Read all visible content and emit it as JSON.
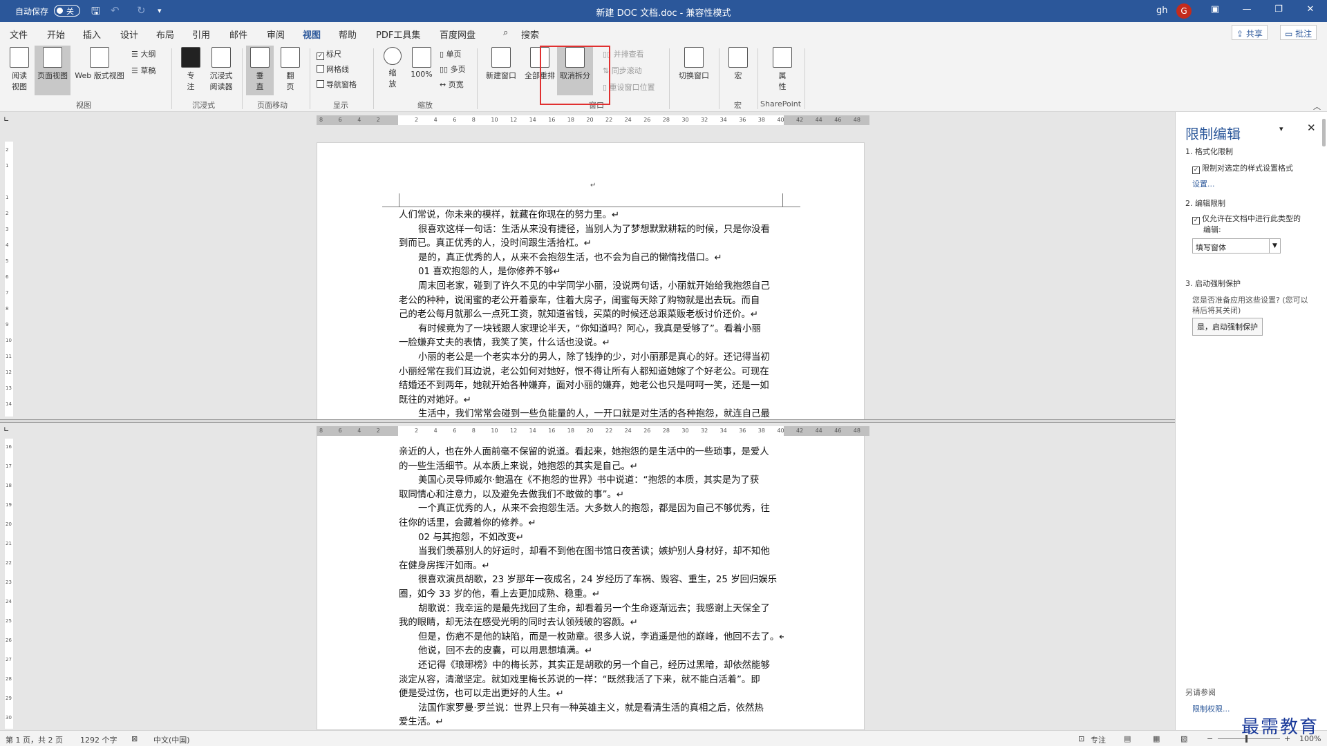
{
  "titlebar": {
    "autosave": "自动保存",
    "toggle": "关",
    "title": "新建 DOC 文档.doc  -  兼容性模式",
    "user": "gh",
    "avatar": "G"
  },
  "tabs": [
    "文件",
    "开始",
    "插入",
    "设计",
    "布局",
    "引用",
    "邮件",
    "审阅",
    "视图",
    "帮助",
    "PDF工具集",
    "百度网盘"
  ],
  "search": "搜索",
  "share": "共享",
  "comment": "批注",
  "ribbon": {
    "read": "阅读视图",
    "print": "页面视图",
    "web": "Web 版式视图",
    "outline": "大纲",
    "draft": "草稿",
    "focus": "专注",
    "immersive": "沉浸式阅读器",
    "vertical": "垂直",
    "side": "翻页",
    "ruler": "标尺",
    "grid": "网格线",
    "nav": "导航窗格",
    "zoom": "缩放",
    "zoom100": "100%",
    "one": "单页",
    "multi": "多页",
    "width": "页宽",
    "newwin": "新建窗口",
    "arrange": "全部重排",
    "unsplit": "取消拆分",
    "sbs": "并排查看",
    "sync": "同步滚动",
    "reset": "重设窗口位置",
    "switch": "切换窗口",
    "macro": "宏",
    "prop": "属性",
    "g_view": "视图",
    "g_imm": "沉浸式",
    "g_move": "页面移动",
    "g_show": "显示",
    "g_zoom": "缩放",
    "g_win": "窗口",
    "g_macro": "宏",
    "g_sp": "SharePoint"
  },
  "ruler_ticks": [
    "8",
    "6",
    "4",
    "2",
    "",
    "2",
    "4",
    "6",
    "8",
    "10",
    "12",
    "14",
    "16",
    "18",
    "20",
    "22",
    "24",
    "26",
    "28",
    "30",
    "32",
    "34",
    "36",
    "38",
    "40",
    "42",
    "44",
    "46",
    "48"
  ],
  "vruler_top": [
    "2",
    "1",
    "",
    "1",
    "2",
    "3",
    "4",
    "5",
    "6",
    "7",
    "8",
    "9",
    "10",
    "11",
    "12",
    "13",
    "14"
  ],
  "vruler_bot": [
    "16",
    "17",
    "18",
    "19",
    "20",
    "21",
    "22",
    "23",
    "24",
    "25",
    "26",
    "27",
    "28",
    "29",
    "30"
  ],
  "page1": [
    {
      "t": "人们常说，你未来的模样，就藏在你现在的努力里。↵",
      "i": 0
    },
    {
      "t": "很喜欢这样一句话：生活从来没有捷径，当别人为了梦想默默耕耘的时候，只是你没看",
      "i": 1
    },
    {
      "t": "到而已。真正优秀的人，没时间跟生活拾杠。↵",
      "i": 0
    },
    {
      "t": "是的，真正优秀的人，从来不会抱怨生活，也不会为自己的懒惰找借口。↵",
      "i": 1
    },
    {
      "t": "01 喜欢抱怨的人，是你修养不够↵",
      "i": 1
    },
    {
      "t": "周末回老家，碰到了许久不见的中学同学小丽，没说两句话，小丽就开始给我抱怨自己",
      "i": 1
    },
    {
      "t": "老公的种种，说闺蜜的老公开着豪车，住着大房子，闺蜜每天除了购物就是出去玩。而自",
      "i": 0
    },
    {
      "t": "己的老公每月就那么一点死工资，就知道省钱，买菜的时候还总跟菜贩老板讨价还价。↵",
      "i": 0
    },
    {
      "t": "有时候竟为了一块钱跟人家理论半天，“你知道吗？阿心，我真是受够了”。看着小丽",
      "i": 1
    },
    {
      "t": "一脸嫌弃丈夫的表情，我笑了笑，什么话也没说。↵",
      "i": 0
    },
    {
      "t": "小丽的老公是一个老实本分的男人，除了钱挣的少，对小丽那是真心的好。还记得当初",
      "i": 1
    },
    {
      "t": "小丽经常在我们耳边说，老公如何对她好，恨不得让所有人都知道她嫁了个好老公。可现在",
      "i": 0
    },
    {
      "t": "结婚还不到两年，她就开始各种嫌弃，面对小丽的嫌弃，她老公也只是呵呵一笑，还是一如",
      "i": 0
    },
    {
      "t": "既往的对她好。↵",
      "i": 0
    },
    {
      "t": "生活中，我们常常会碰到一些负能量的人，一开口就是对生活的各种抱怨，就连自己最",
      "i": 1
    }
  ],
  "page2": [
    {
      "t": "亲近的人，也在外人面前毫不保留的说道。看起来，她抱怨的是生活中的一些琐事，是爱人",
      "i": 0
    },
    {
      "t": "的一些生活细节。从本质上来说，她抱怨的其实是自己。↵",
      "i": 0
    },
    {
      "t": "美国心灵导师威尔·鲍温在《不抱怨的世界》书中说道：“抱怨的本质，其实是为了获",
      "i": 1
    },
    {
      "t": "取同情心和注意力，以及避免去做我们不敢做的事”。↵",
      "i": 0
    },
    {
      "t": "一个真正优秀的人，从来不会抱怨生活。大多数人的抱怨，都是因为自己不够优秀，往",
      "i": 1
    },
    {
      "t": "往你的话里，会藏着你的修养。↵",
      "i": 0
    },
    {
      "t": "02 与其抱怨，不如改变↵",
      "i": 1
    },
    {
      "t": "当我们羡慕别人的好运时，却看不到他在图书馆日夜苦读；嫉妒别人身材好，却不知他",
      "i": 1
    },
    {
      "t": "在健身房挥汗如雨。↵",
      "i": 0
    },
    {
      "t": "很喜欢演员胡歌，23 岁那年一夜成名，24 岁经历了车祸、毁容、重生，25 岁回归娱乐",
      "i": 1
    },
    {
      "t": "圈，如今 33 岁的他，看上去更加成熟、稳重。↵",
      "i": 0
    },
    {
      "t": "胡歌说：我幸运的是最先找回了生命，却看着另一个生命逐渐远去；我感谢上天保全了",
      "i": 1
    },
    {
      "t": "我的眼睛，却无法在感受光明的同时去认领残破的容颜。↵",
      "i": 0
    },
    {
      "t": "但是，伤疤不是他的缺陷，而是一枚勋章。很多人说，李逍遥是他的巅峰，他回不去了。↵",
      "i": 1
    },
    {
      "t": "他说，回不去的皮囊，可以用思想填满。↵",
      "i": 1
    },
    {
      "t": "还记得《琅琊榜》中的梅长苏，其实正是胡歌的另一个自己，经历过黑暗，却依然能够",
      "i": 1
    },
    {
      "t": "淡定从容，清澈坚定。就如戏里梅长苏说的一样：“既然我活了下来，就不能白活着”。即",
      "i": 0
    },
    {
      "t": "便是受过伤，也可以走出更好的人生。↵",
      "i": 0
    },
    {
      "t": "法国作家罗曼·罗兰说：世界上只有一种英雄主义，就是看清生活的真相之后，依然热",
      "i": 1
    },
    {
      "t": "爱生活。↵",
      "i": 0
    }
  ],
  "pane": {
    "title": "限制编辑",
    "s1": "1. 格式化限制",
    "c1": "限制对选定的样式设置格式",
    "settings": "设置...",
    "s2": "2. 编辑限制",
    "c2a": "仅允许在文档中进行此类型的",
    "c2b": "编辑:",
    "select": "填写窗体",
    "s3": "3. 启动强制保护",
    "q1": "您是否准备应用这些设置? (您可以",
    "q2": "稍后将其关闭)",
    "start": "是，启动强制保护",
    "see": "另请参阅",
    "perm": "限制权限..."
  },
  "status": {
    "page": "第 1 页，共 2 页",
    "words": "1292 个字",
    "lang": "中文(中国)",
    "focus": "专注",
    "zoom": "100%"
  },
  "watermark": "最需教育"
}
